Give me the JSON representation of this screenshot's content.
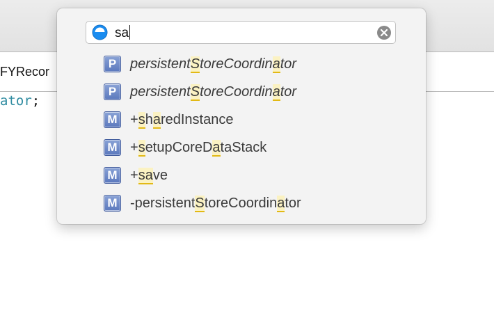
{
  "background": {
    "jumpbar_text": "FYRecor",
    "code_ident": "ator",
    "code_punct": ";"
  },
  "search": {
    "value": "sa",
    "icon": "open-quickly-circle-icon",
    "clear_icon": "clear-x-icon"
  },
  "results": [
    {
      "kind": "P",
      "italic": true,
      "segments": [
        {
          "t": "persistent",
          "h": false
        },
        {
          "t": "S",
          "h": true
        },
        {
          "t": "toreCoordin",
          "h": false
        },
        {
          "t": "a",
          "h": true
        },
        {
          "t": "tor",
          "h": false
        }
      ]
    },
    {
      "kind": "P",
      "italic": true,
      "segments": [
        {
          "t": "persistent",
          "h": false
        },
        {
          "t": "S",
          "h": true
        },
        {
          "t": "toreCoordin",
          "h": false
        },
        {
          "t": "a",
          "h": true
        },
        {
          "t": "tor",
          "h": false
        }
      ]
    },
    {
      "kind": "M",
      "italic": false,
      "segments": [
        {
          "t": "+",
          "h": false
        },
        {
          "t": "s",
          "h": true
        },
        {
          "t": "h",
          "h": false
        },
        {
          "t": "a",
          "h": true
        },
        {
          "t": "redInstance",
          "h": false
        }
      ]
    },
    {
      "kind": "M",
      "italic": false,
      "segments": [
        {
          "t": "+",
          "h": false
        },
        {
          "t": "s",
          "h": true
        },
        {
          "t": "etupCoreD",
          "h": false
        },
        {
          "t": "a",
          "h": true
        },
        {
          "t": "taStack",
          "h": false
        }
      ]
    },
    {
      "kind": "M",
      "italic": false,
      "segments": [
        {
          "t": "+",
          "h": false
        },
        {
          "t": "sa",
          "h": true
        },
        {
          "t": "ve",
          "h": false
        }
      ]
    },
    {
      "kind": "M",
      "italic": false,
      "segments": [
        {
          "t": "-persistent",
          "h": false
        },
        {
          "t": "S",
          "h": true
        },
        {
          "t": "toreCoordin",
          "h": false
        },
        {
          "t": "a",
          "h": true
        },
        {
          "t": "tor",
          "h": false
        }
      ]
    }
  ]
}
